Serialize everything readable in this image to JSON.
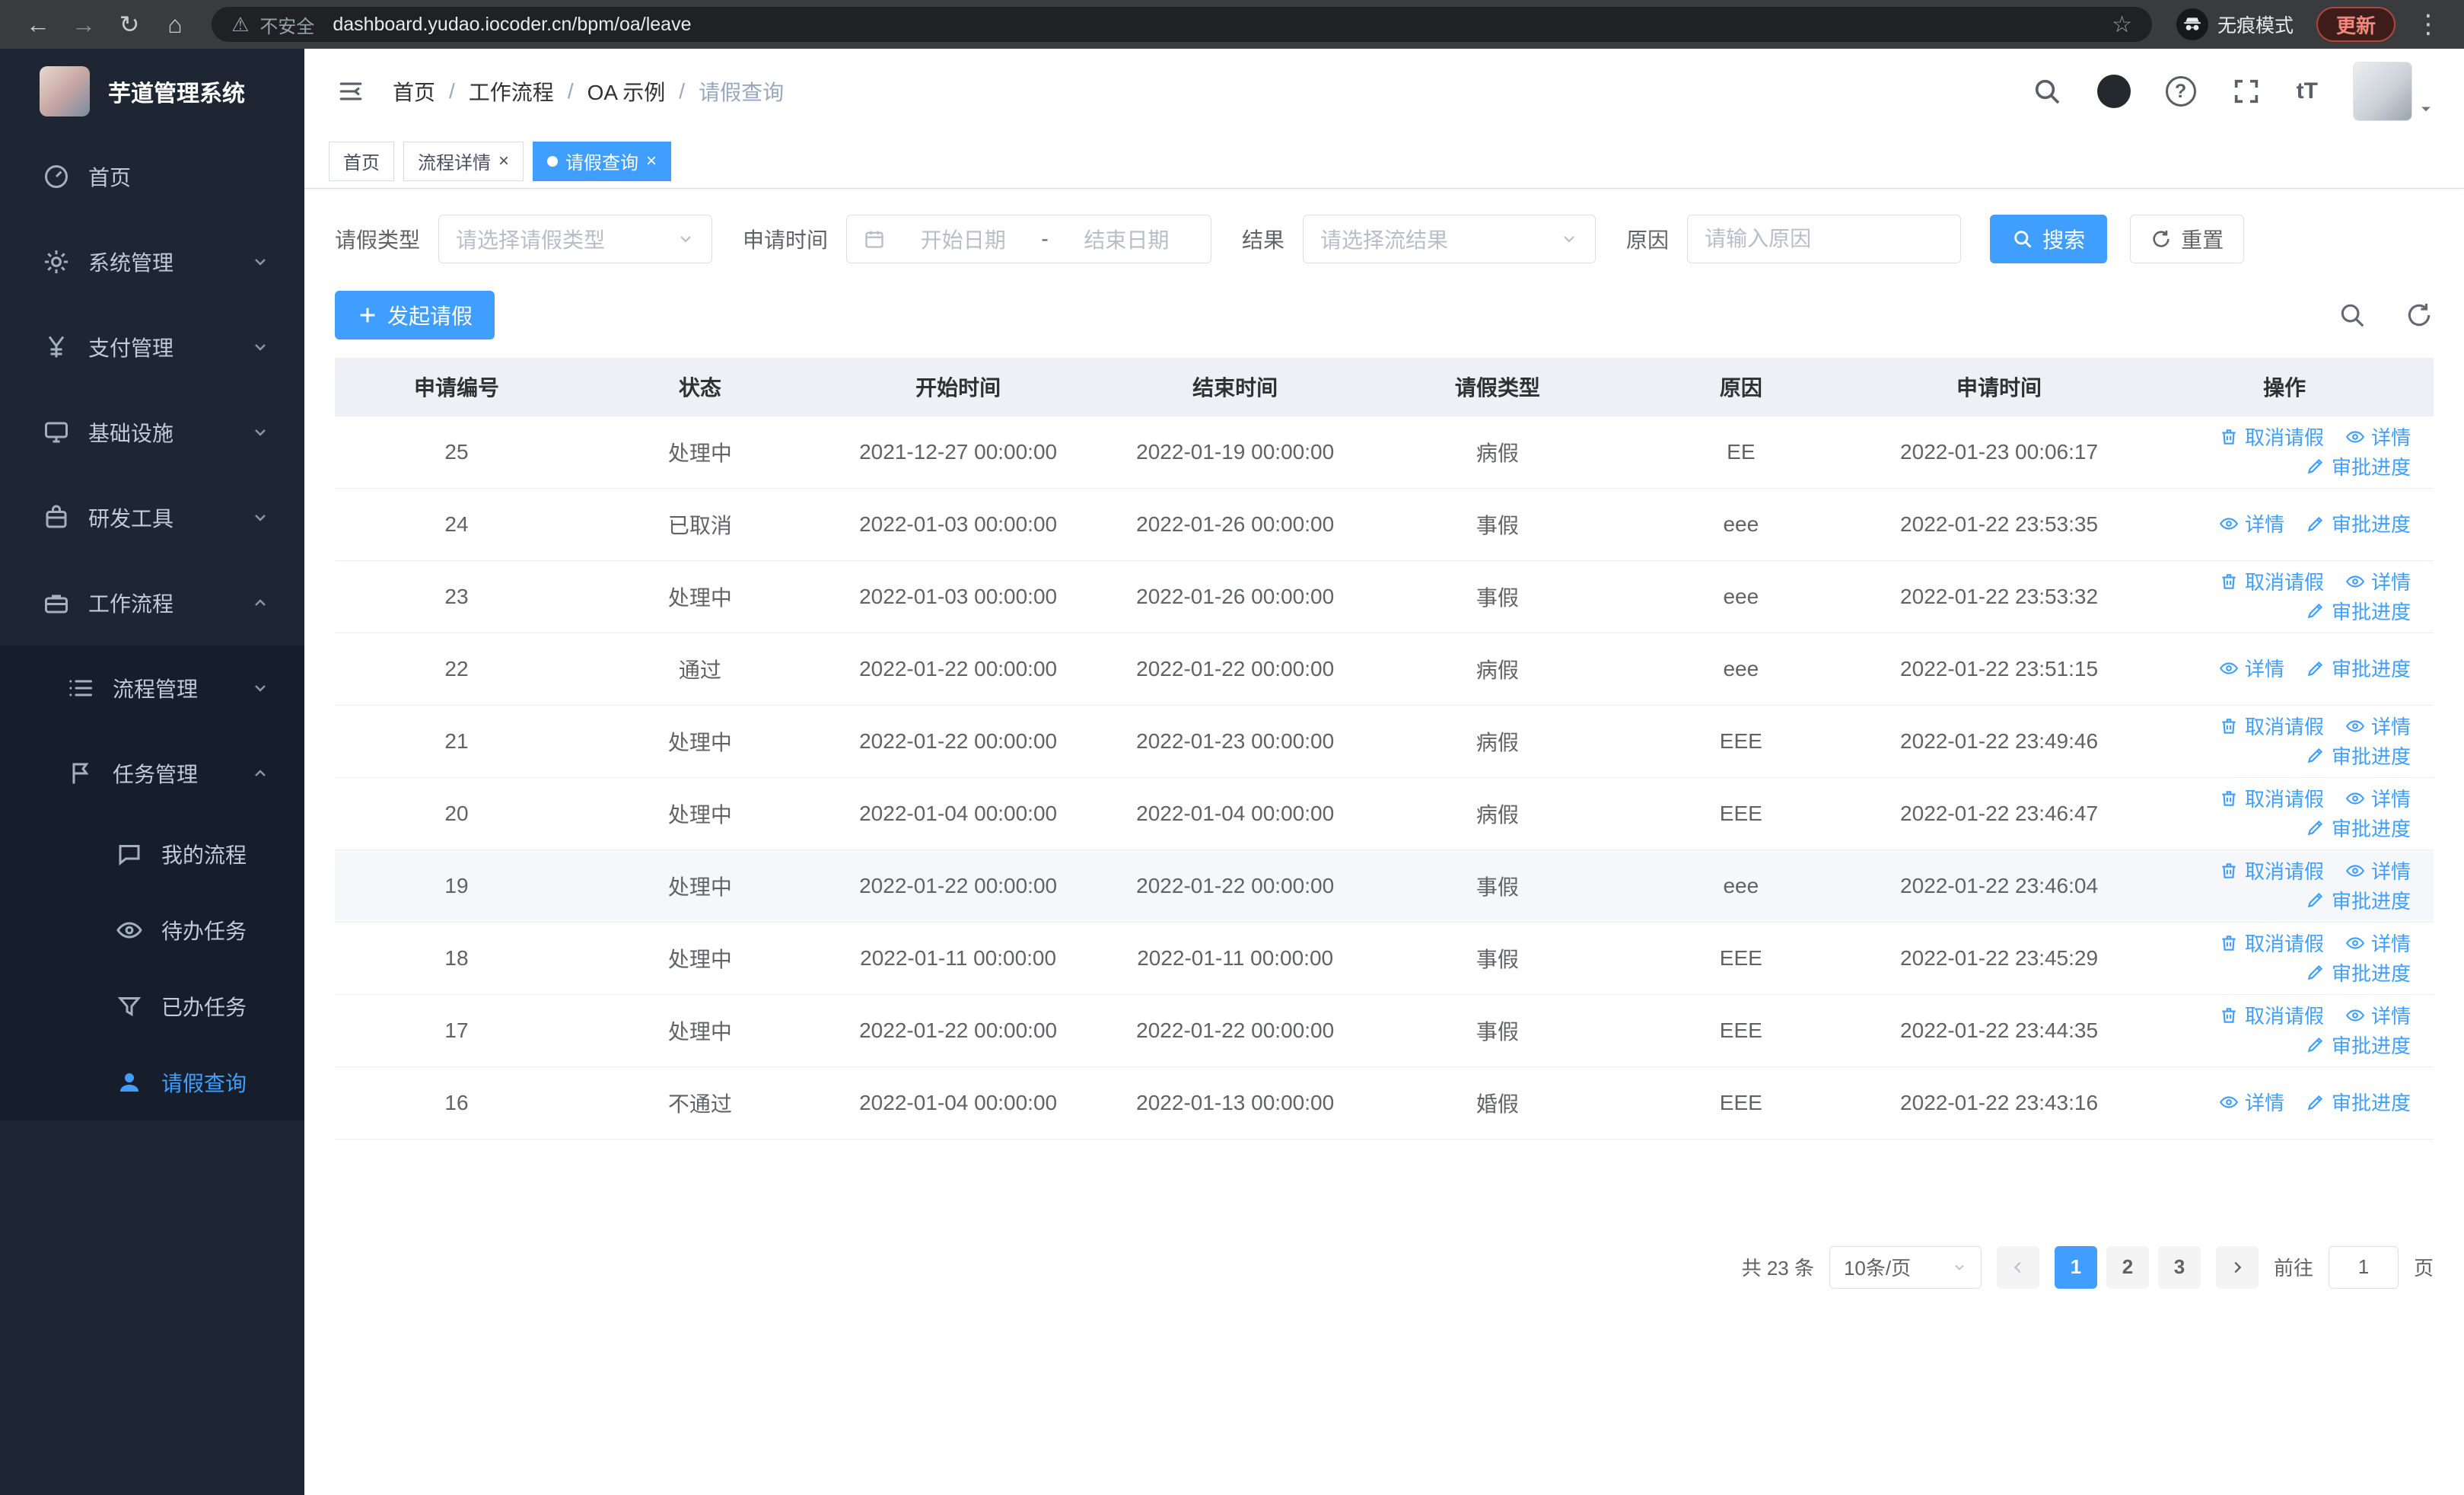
{
  "browser": {
    "security_label": "不安全",
    "url": "dashboard.yudao.iocoder.cn/bpm/oa/leave",
    "incognito_label": "无痕模式",
    "update_label": "更新"
  },
  "sidebar": {
    "title": "芋道管理系统",
    "items": [
      {
        "label": "首页"
      },
      {
        "label": "系统管理"
      },
      {
        "label": "支付管理"
      },
      {
        "label": "基础设施"
      },
      {
        "label": "研发工具"
      },
      {
        "label": "工作流程"
      },
      {
        "label": "流程管理"
      },
      {
        "label": "任务管理"
      },
      {
        "label": "我的流程"
      },
      {
        "label": "待办任务"
      },
      {
        "label": "已办任务"
      },
      {
        "label": "请假查询"
      }
    ]
  },
  "breadcrumb": {
    "separator": "/",
    "items": [
      "首页",
      "工作流程",
      "OA 示例",
      "请假查询"
    ]
  },
  "tabs": [
    {
      "label": "首页",
      "active": false,
      "closable": false
    },
    {
      "label": "流程详情",
      "active": false,
      "closable": true
    },
    {
      "label": "请假查询",
      "active": true,
      "closable": true
    }
  ],
  "filters": {
    "leave_type_label": "请假类型",
    "leave_type_placeholder": "请选择请假类型",
    "apply_time_label": "申请时间",
    "start_date_placeholder": "开始日期",
    "range_separator": "-",
    "end_date_placeholder": "结束日期",
    "result_label": "结果",
    "result_placeholder": "请选择流结果",
    "reason_label": "原因",
    "reason_placeholder": "请输入原因",
    "search_label": "搜索",
    "reset_label": "重置"
  },
  "toolbar": {
    "create_label": "发起请假"
  },
  "table": {
    "columns": [
      "申请编号",
      "状态",
      "开始时间",
      "结束时间",
      "请假类型",
      "原因",
      "申请时间",
      "操作"
    ],
    "column_keys": [
      "no",
      "status",
      "start_time",
      "end_time",
      "leave_type",
      "reason",
      "apply_time"
    ],
    "action_labels": {
      "cancel": "取消请假",
      "detail": "详情",
      "progress": "审批进度"
    },
    "rows": [
      {
        "no": "25",
        "status": "处理中",
        "start_time": "2021-12-27 00:00:00",
        "end_time": "2022-01-19 00:00:00",
        "leave_type": "病假",
        "reason": "EE",
        "apply_time": "2022-01-23 00:06:17",
        "actions": [
          "cancel",
          "detail",
          "progress"
        ]
      },
      {
        "no": "24",
        "status": "已取消",
        "start_time": "2022-01-03 00:00:00",
        "end_time": "2022-01-26 00:00:00",
        "leave_type": "事假",
        "reason": "eee",
        "apply_time": "2022-01-22 23:53:35",
        "actions": [
          "detail",
          "progress"
        ]
      },
      {
        "no": "23",
        "status": "处理中",
        "start_time": "2022-01-03 00:00:00",
        "end_time": "2022-01-26 00:00:00",
        "leave_type": "事假",
        "reason": "eee",
        "apply_time": "2022-01-22 23:53:32",
        "actions": [
          "cancel",
          "detail",
          "progress"
        ]
      },
      {
        "no": "22",
        "status": "通过",
        "start_time": "2022-01-22 00:00:00",
        "end_time": "2022-01-22 00:00:00",
        "leave_type": "病假",
        "reason": "eee",
        "apply_time": "2022-01-22 23:51:15",
        "actions": [
          "detail",
          "progress"
        ]
      },
      {
        "no": "21",
        "status": "处理中",
        "start_time": "2022-01-22 00:00:00",
        "end_time": "2022-01-23 00:00:00",
        "leave_type": "病假",
        "reason": "EEE",
        "apply_time": "2022-01-22 23:49:46",
        "actions": [
          "cancel",
          "detail",
          "progress"
        ]
      },
      {
        "no": "20",
        "status": "处理中",
        "start_time": "2022-01-04 00:00:00",
        "end_time": "2022-01-04 00:00:00",
        "leave_type": "病假",
        "reason": "EEE",
        "apply_time": "2022-01-22 23:46:47",
        "actions": [
          "cancel",
          "detail",
          "progress"
        ]
      },
      {
        "no": "19",
        "status": "处理中",
        "start_time": "2022-01-22 00:00:00",
        "end_time": "2022-01-22 00:00:00",
        "leave_type": "事假",
        "reason": "eee",
        "apply_time": "2022-01-22 23:46:04",
        "actions": [
          "cancel",
          "detail",
          "progress"
        ],
        "highlighted": true
      },
      {
        "no": "18",
        "status": "处理中",
        "start_time": "2022-01-11 00:00:00",
        "end_time": "2022-01-11 00:00:00",
        "leave_type": "事假",
        "reason": "EEE",
        "apply_time": "2022-01-22 23:45:29",
        "actions": [
          "cancel",
          "detail",
          "progress"
        ]
      },
      {
        "no": "17",
        "status": "处理中",
        "start_time": "2022-01-22 00:00:00",
        "end_time": "2022-01-22 00:00:00",
        "leave_type": "事假",
        "reason": "EEE",
        "apply_time": "2022-01-22 23:44:35",
        "actions": [
          "cancel",
          "detail",
          "progress"
        ]
      },
      {
        "no": "16",
        "status": "不通过",
        "start_time": "2022-01-04 00:00:00",
        "end_time": "2022-01-13 00:00:00",
        "leave_type": "婚假",
        "reason": "EEE",
        "apply_time": "2022-01-22 23:43:16",
        "actions": [
          "detail",
          "progress"
        ]
      }
    ]
  },
  "pagination": {
    "total_label": "共 23 条",
    "page_size_label": "10条/页",
    "pages": [
      "1",
      "2",
      "3"
    ],
    "active_page": "1",
    "goto_label": "前往",
    "goto_value": "1",
    "unit_label": "页"
  }
}
